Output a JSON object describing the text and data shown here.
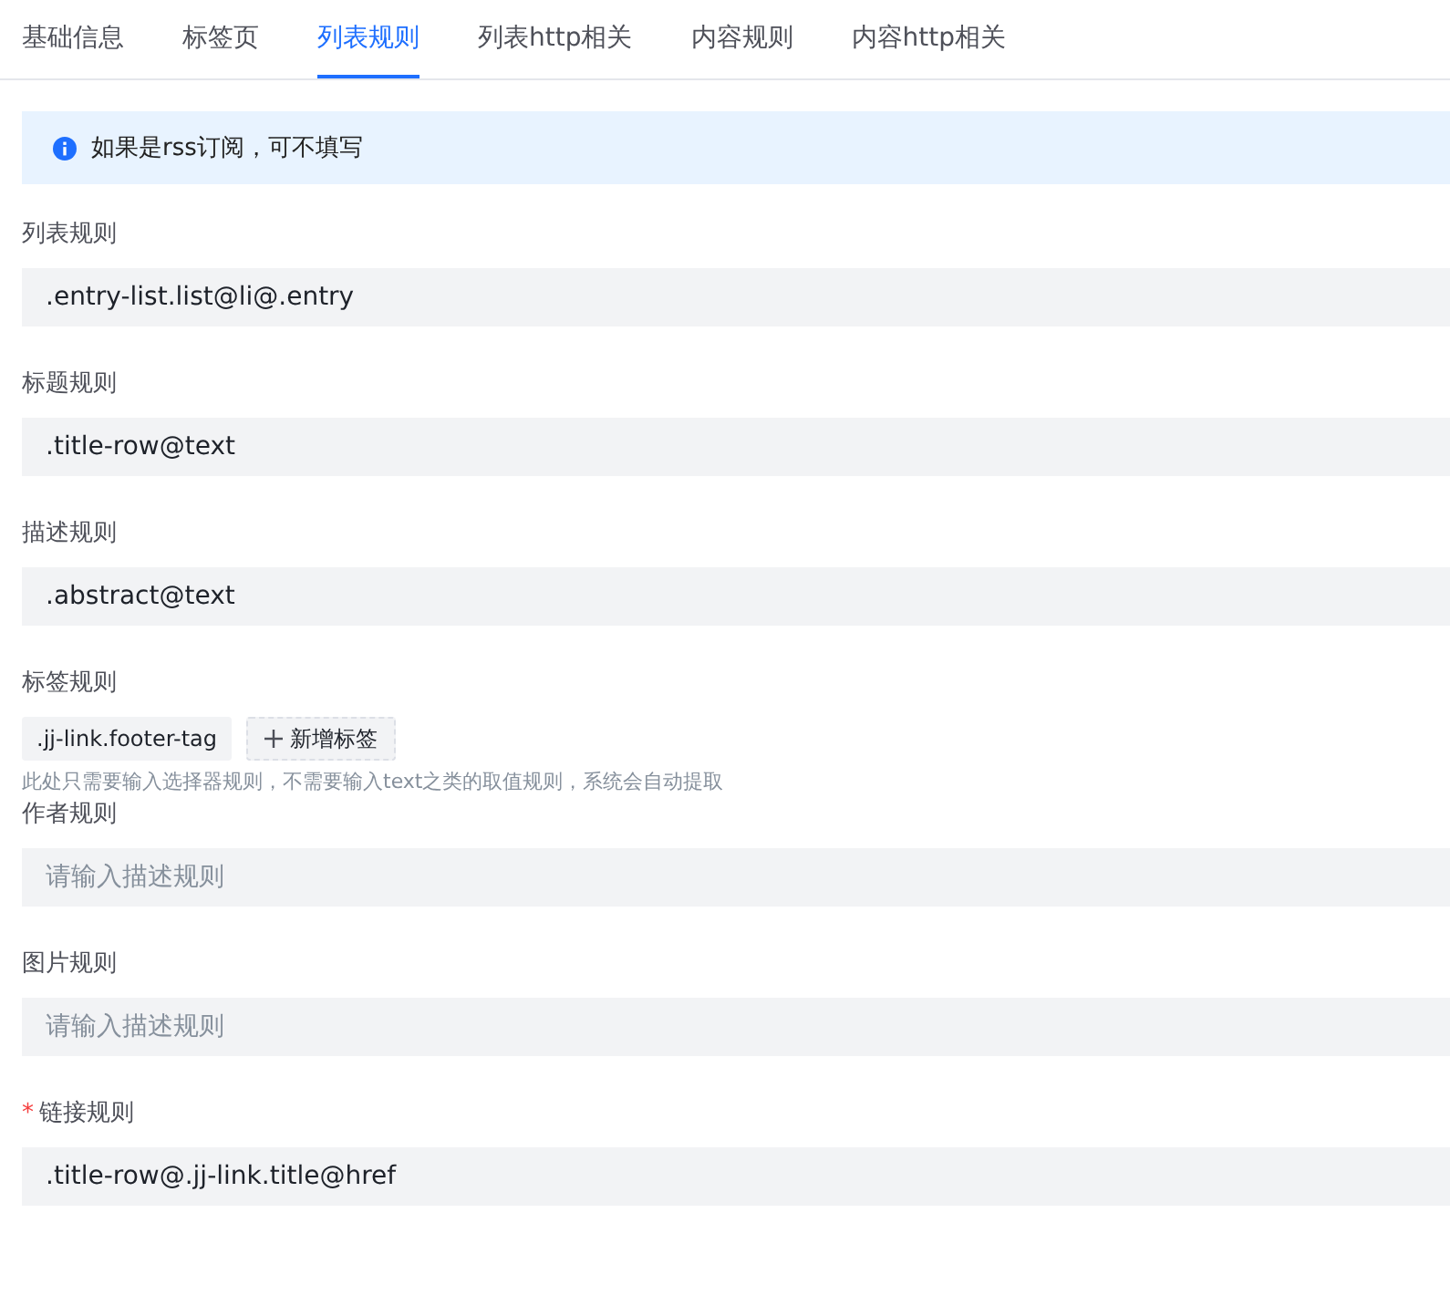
{
  "tabs": [
    {
      "label": "基础信息",
      "selected": false
    },
    {
      "label": "标签页",
      "selected": false
    },
    {
      "label": "列表规则",
      "selected": true
    },
    {
      "label": "列表http相关",
      "selected": false
    },
    {
      "label": "内容规则",
      "selected": false
    },
    {
      "label": "内容http相关",
      "selected": false
    }
  ],
  "alert": {
    "text": "如果是rss订阅，可不填写"
  },
  "fields": [
    {
      "kind": "input",
      "label": "列表规则",
      "value": ".entry-list.list@li@.entry"
    },
    {
      "kind": "input",
      "label": "标题规则",
      "value": ".title-row@text"
    },
    {
      "kind": "input",
      "label": "描述规则",
      "value": ".abstract@text"
    },
    {
      "kind": "tags",
      "label": "标签规则",
      "tags": [
        ".jj-link.footer-tag"
      ],
      "add_label": "新增标签",
      "hint": "此处只需要输入选择器规则，不需要输入text之类的取值规则，系统会自动提取"
    },
    {
      "kind": "input",
      "label": "作者规则",
      "placeholder": "请输入描述规则"
    },
    {
      "kind": "input",
      "label": "图片规则",
      "placeholder": "请输入描述规则"
    },
    {
      "kind": "input",
      "label": "链接规则",
      "required_mark": "*",
      "value": ".title-row@.jj-link.title@href"
    }
  ]
}
